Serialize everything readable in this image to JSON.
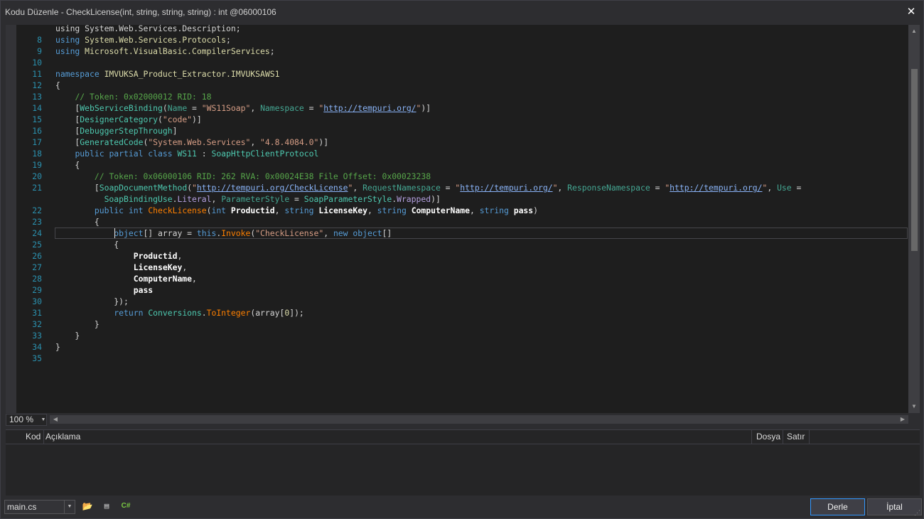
{
  "window": {
    "title": "Kodu Düzenle - CheckLicense(int, string, string, string) : int @06000106",
    "close_label": "✕"
  },
  "editor": {
    "current_line": 24,
    "lines": [
      {
        "n": "",
        "segs": [
          [
            "pl",
            "using System.Web.Services.Description;"
          ]
        ],
        "partial": true
      },
      {
        "n": "8",
        "segs": [
          [
            "kw",
            "using "
          ],
          [
            "nm",
            "System.Web.Services.Protocols"
          ],
          [
            "pl",
            ";"
          ]
        ]
      },
      {
        "n": "9",
        "segs": [
          [
            "kw",
            "using "
          ],
          [
            "nm",
            "Microsoft.VisualBasic.CompilerServices"
          ],
          [
            "pl",
            ";"
          ]
        ]
      },
      {
        "n": "10",
        "segs": []
      },
      {
        "n": "11",
        "segs": [
          [
            "kw",
            "namespace "
          ],
          [
            "nm",
            "IMVUKSA_Product_Extractor.IMVUKSAWS1"
          ]
        ]
      },
      {
        "n": "12",
        "segs": [
          [
            "pl",
            "{"
          ]
        ]
      },
      {
        "n": "13",
        "segs": [
          [
            "pl",
            "    "
          ],
          [
            "cm",
            "// Token: 0x02000012 RID: 18"
          ]
        ]
      },
      {
        "n": "14",
        "segs": [
          [
            "pl",
            "    ["
          ],
          [
            "ty",
            "WebServiceBinding"
          ],
          [
            "pl",
            "("
          ],
          [
            "arg",
            "Name"
          ],
          [
            "pl",
            " = "
          ],
          [
            "str",
            "\"WS11Soap\""
          ],
          [
            "pl",
            ", "
          ],
          [
            "arg",
            "Namespace"
          ],
          [
            "pl",
            " = "
          ],
          [
            "str",
            "\""
          ],
          [
            "lnk",
            "http://tempuri.org/"
          ],
          [
            "str",
            "\""
          ],
          [
            "pl",
            ")]"
          ]
        ]
      },
      {
        "n": "15",
        "segs": [
          [
            "pl",
            "    ["
          ],
          [
            "ty",
            "DesignerCategory"
          ],
          [
            "pl",
            "("
          ],
          [
            "str",
            "\"code\""
          ],
          [
            "pl",
            ")]"
          ]
        ]
      },
      {
        "n": "16",
        "segs": [
          [
            "pl",
            "    ["
          ],
          [
            "ty",
            "DebuggerStepThrough"
          ],
          [
            "pl",
            "]"
          ]
        ]
      },
      {
        "n": "17",
        "segs": [
          [
            "pl",
            "    ["
          ],
          [
            "ty",
            "GeneratedCode"
          ],
          [
            "pl",
            "("
          ],
          [
            "str",
            "\"System.Web.Services\""
          ],
          [
            "pl",
            ", "
          ],
          [
            "str",
            "\"4.8.4084.0\""
          ],
          [
            "pl",
            ")]"
          ]
        ]
      },
      {
        "n": "18",
        "segs": [
          [
            "pl",
            "    "
          ],
          [
            "kw",
            "public partial class "
          ],
          [
            "ty",
            "WS11"
          ],
          [
            "pl",
            " : "
          ],
          [
            "ty",
            "SoapHttpClientProtocol"
          ]
        ]
      },
      {
        "n": "19",
        "segs": [
          [
            "pl",
            "    {"
          ]
        ]
      },
      {
        "n": "20",
        "segs": [
          [
            "pl",
            "        "
          ],
          [
            "cm",
            "// Token: 0x06000106 RID: 262 RVA: 0x00024E38 File Offset: 0x00023238"
          ]
        ]
      },
      {
        "n": "21",
        "segs": [
          [
            "pl",
            "        ["
          ],
          [
            "ty",
            "SoapDocumentMethod"
          ],
          [
            "pl",
            "("
          ],
          [
            "str",
            "\""
          ],
          [
            "lnk",
            "http://tempuri.org/CheckLicense"
          ],
          [
            "str",
            "\""
          ],
          [
            "pl",
            ", "
          ],
          [
            "arg",
            "RequestNamespace"
          ],
          [
            "pl",
            " = "
          ],
          [
            "str",
            "\""
          ],
          [
            "lnk",
            "http://tempuri.org/"
          ],
          [
            "str",
            "\""
          ],
          [
            "pl",
            ", "
          ],
          [
            "arg",
            "ResponseNamespace"
          ],
          [
            "pl",
            " = "
          ],
          [
            "str",
            "\""
          ],
          [
            "lnk",
            "http://tempuri.org/"
          ],
          [
            "str",
            "\""
          ],
          [
            "pl",
            ", "
          ],
          [
            "arg",
            "Use"
          ],
          [
            "pl",
            " ="
          ]
        ]
      },
      {
        "n": "",
        "segs": [
          [
            "pl",
            "          "
          ],
          [
            "ty",
            "SoapBindingUse"
          ],
          [
            "pl",
            "."
          ],
          [
            "prm",
            "Literal"
          ],
          [
            "pl",
            ", "
          ],
          [
            "arg",
            "ParameterStyle"
          ],
          [
            "pl",
            " = "
          ],
          [
            "ty",
            "SoapParameterStyle"
          ],
          [
            "pl",
            "."
          ],
          [
            "prm",
            "Wrapped"
          ],
          [
            "pl",
            ")]"
          ]
        ]
      },
      {
        "n": "22",
        "segs": [
          [
            "pl",
            "        "
          ],
          [
            "kw",
            "public int "
          ],
          [
            "fn",
            "CheckLicense"
          ],
          [
            "pl",
            "("
          ],
          [
            "kw",
            "int "
          ],
          [
            "bold",
            "Productid"
          ],
          [
            "pl",
            ", "
          ],
          [
            "kw",
            "string "
          ],
          [
            "bold",
            "LicenseKey"
          ],
          [
            "pl",
            ", "
          ],
          [
            "kw",
            "string "
          ],
          [
            "bold",
            "ComputerName"
          ],
          [
            "pl",
            ", "
          ],
          [
            "kw",
            "string "
          ],
          [
            "bold",
            "pass"
          ],
          [
            "pl",
            ")"
          ]
        ]
      },
      {
        "n": "23",
        "segs": [
          [
            "pl",
            "        {"
          ]
        ]
      },
      {
        "n": "24",
        "segs": [
          [
            "pl",
            "            "
          ],
          [
            "kw",
            "object"
          ],
          [
            "pl",
            "[] array = "
          ],
          [
            "kw",
            "this"
          ],
          [
            "pl",
            "."
          ],
          [
            "fn",
            "Invoke"
          ],
          [
            "pl",
            "("
          ],
          [
            "str",
            "\"CheckLicense\""
          ],
          [
            "pl",
            ", "
          ],
          [
            "kw",
            "new object"
          ],
          [
            "pl",
            "[]"
          ]
        ]
      },
      {
        "n": "25",
        "segs": [
          [
            "pl",
            "            {"
          ]
        ]
      },
      {
        "n": "26",
        "segs": [
          [
            "pl",
            "                "
          ],
          [
            "bold",
            "Productid"
          ],
          [
            "pl",
            ","
          ]
        ]
      },
      {
        "n": "27",
        "segs": [
          [
            "pl",
            "                "
          ],
          [
            "bold",
            "LicenseKey"
          ],
          [
            "pl",
            ","
          ]
        ]
      },
      {
        "n": "28",
        "segs": [
          [
            "pl",
            "                "
          ],
          [
            "bold",
            "ComputerName"
          ],
          [
            "pl",
            ","
          ]
        ]
      },
      {
        "n": "29",
        "segs": [
          [
            "pl",
            "                "
          ],
          [
            "bold",
            "pass"
          ]
        ]
      },
      {
        "n": "30",
        "segs": [
          [
            "pl",
            "            });"
          ]
        ]
      },
      {
        "n": "31",
        "segs": [
          [
            "pl",
            "            "
          ],
          [
            "kw",
            "return "
          ],
          [
            "ty",
            "Conversions"
          ],
          [
            "pl",
            "."
          ],
          [
            "fn",
            "ToInteger"
          ],
          [
            "pl",
            "(array["
          ],
          [
            "nm",
            "0"
          ],
          [
            "pl",
            "]);"
          ]
        ]
      },
      {
        "n": "32",
        "segs": [
          [
            "pl",
            "        }"
          ]
        ]
      },
      {
        "n": "33",
        "segs": [
          [
            "pl",
            "    }"
          ]
        ]
      },
      {
        "n": "34",
        "segs": [
          [
            "pl",
            "}"
          ]
        ]
      },
      {
        "n": "35",
        "segs": []
      }
    ]
  },
  "zoom": {
    "value": "100 %"
  },
  "errors": {
    "columns": {
      "code": "Kod",
      "description": "Açıklama",
      "file": "Dosya",
      "line": "Satır"
    }
  },
  "footer": {
    "file": "main.cs",
    "compile_label": "Derle",
    "cancel_label": "İptal",
    "icons": [
      "folder-open-icon",
      "references-icon",
      "csharp-icon"
    ]
  },
  "colors": {
    "keyword": "#569cd6",
    "type": "#4ec9b0",
    "string": "#d69d85",
    "comment": "#57a64a",
    "method": "#ff8000",
    "line_number": "#2b91af"
  }
}
